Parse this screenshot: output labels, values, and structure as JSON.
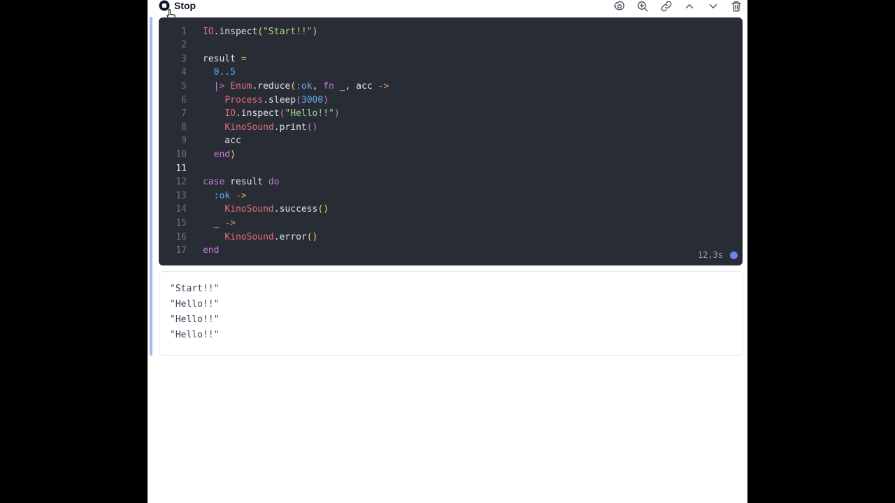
{
  "toolbar": {
    "stop_label": "Stop",
    "icons": [
      "settings-icon",
      "zoom-in-icon",
      "link-icon",
      "chevron-up-icon",
      "chevron-down-icon",
      "trash-icon"
    ]
  },
  "editor": {
    "theme": {
      "background": "#282c34",
      "module": "#e26d7a",
      "string": "#a6d68a",
      "number": "#61aeee",
      "keyword": "#c678dd"
    },
    "lines": [
      {
        "n": "1",
        "tokens": [
          [
            "t-mod",
            "IO"
          ],
          [
            "t-def",
            ".inspect"
          ],
          [
            "t-par1",
            "("
          ],
          [
            "t-str",
            "\"Start!!\""
          ],
          [
            "t-par1",
            ")"
          ]
        ]
      },
      {
        "n": "2",
        "tokens": []
      },
      {
        "n": "3",
        "tokens": [
          [
            "t-def",
            "result "
          ],
          [
            "t-op",
            "="
          ]
        ]
      },
      {
        "n": "4",
        "tokens": [
          [
            "t-def",
            "  "
          ],
          [
            "t-num",
            "0..5"
          ]
        ]
      },
      {
        "n": "5",
        "tokens": [
          [
            "t-def",
            "  "
          ],
          [
            "t-pipe",
            "|>"
          ],
          [
            "t-def",
            " "
          ],
          [
            "t-mod",
            "Enum"
          ],
          [
            "t-def",
            ".reduce"
          ],
          [
            "t-par1",
            "("
          ],
          [
            "t-atom",
            ":ok"
          ],
          [
            "t-def",
            ", "
          ],
          [
            "t-kw",
            "fn"
          ],
          [
            "t-def",
            " _, acc "
          ],
          [
            "t-op",
            "->"
          ]
        ]
      },
      {
        "n": "6",
        "tokens": [
          [
            "t-def",
            "    "
          ],
          [
            "t-mod",
            "Process"
          ],
          [
            "t-def",
            ".sleep"
          ],
          [
            "t-par2",
            "("
          ],
          [
            "t-num",
            "3000"
          ],
          [
            "t-par2",
            ")"
          ]
        ]
      },
      {
        "n": "7",
        "tokens": [
          [
            "t-def",
            "    "
          ],
          [
            "t-mod",
            "IO"
          ],
          [
            "t-def",
            ".inspect"
          ],
          [
            "t-par2",
            "("
          ],
          [
            "t-str",
            "\"Hello!!\""
          ],
          [
            "t-par2",
            ")"
          ]
        ]
      },
      {
        "n": "8",
        "tokens": [
          [
            "t-def",
            "    "
          ],
          [
            "t-mod",
            "KinoSound"
          ],
          [
            "t-def",
            ".print"
          ],
          [
            "t-par2",
            "()"
          ]
        ]
      },
      {
        "n": "9",
        "tokens": [
          [
            "t-def",
            "    acc"
          ]
        ]
      },
      {
        "n": "10",
        "tokens": [
          [
            "t-def",
            "  "
          ],
          [
            "t-kw",
            "end"
          ],
          [
            "t-par1",
            ")"
          ]
        ]
      },
      {
        "n": "11",
        "tokens": [],
        "active": true
      },
      {
        "n": "12",
        "tokens": [
          [
            "t-kw",
            "case"
          ],
          [
            "t-def",
            " result "
          ],
          [
            "t-kw",
            "do"
          ]
        ]
      },
      {
        "n": "13",
        "tokens": [
          [
            "t-def",
            "  "
          ],
          [
            "t-atom",
            ":ok"
          ],
          [
            "t-def",
            " "
          ],
          [
            "t-op",
            "->"
          ]
        ]
      },
      {
        "n": "14",
        "tokens": [
          [
            "t-def",
            "    "
          ],
          [
            "t-mod",
            "KinoSound"
          ],
          [
            "t-def",
            ".success"
          ],
          [
            "t-par1",
            "()"
          ]
        ]
      },
      {
        "n": "15",
        "tokens": [
          [
            "t-def",
            "  _ "
          ],
          [
            "t-op",
            "->"
          ]
        ]
      },
      {
        "n": "16",
        "tokens": [
          [
            "t-def",
            "    "
          ],
          [
            "t-mod",
            "KinoSound"
          ],
          [
            "t-def",
            ".error"
          ],
          [
            "t-par1",
            "()"
          ]
        ]
      },
      {
        "n": "17",
        "tokens": [
          [
            "t-kw",
            "end"
          ]
        ]
      }
    ],
    "elapsed": "12.3s"
  },
  "output": {
    "lines": [
      "\"Start!!\"",
      "\"Hello!!\"",
      "\"Hello!!\"",
      "\"Hello!!\""
    ]
  }
}
